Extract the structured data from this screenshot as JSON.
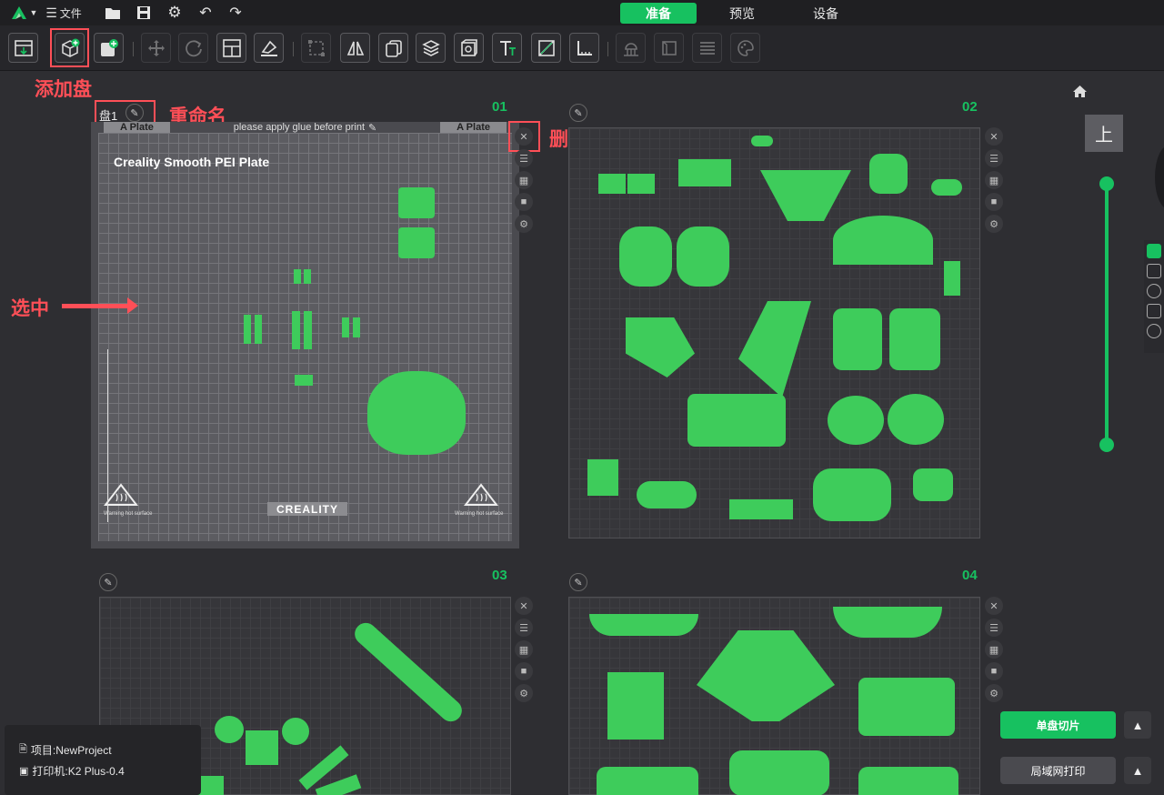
{
  "menu": {
    "file_label": "文件"
  },
  "modes": {
    "prepare": "准备",
    "preview": "预览",
    "device": "设备"
  },
  "colors": {
    "accent": "#17c160",
    "annotation": "#ff4f57",
    "model": "#3ecc5b"
  },
  "annotations": {
    "add_plate": "添加盘",
    "rename": "重命名",
    "delete": "删除",
    "selected": "选中"
  },
  "plates": [
    {
      "number": "01",
      "name": "盘1",
      "bed_title": "Creality Smooth PEI Plate",
      "left_tag": "A Plate",
      "right_tag": "A Plate",
      "notice": "please apply glue before print",
      "brand": "CREALITY",
      "warning_left": "Warning hot surface",
      "warning_right": "Warning hot surface"
    },
    {
      "number": "02"
    },
    {
      "number": "03"
    },
    {
      "number": "04"
    }
  ],
  "view": {
    "top_view_label": "上"
  },
  "project": {
    "project_label": "项目:NewProject",
    "printer_label": "打印机:K2 Plus-0.4"
  },
  "actions": {
    "slice_plate": "单盘切片",
    "lan_print": "局域网打印"
  }
}
